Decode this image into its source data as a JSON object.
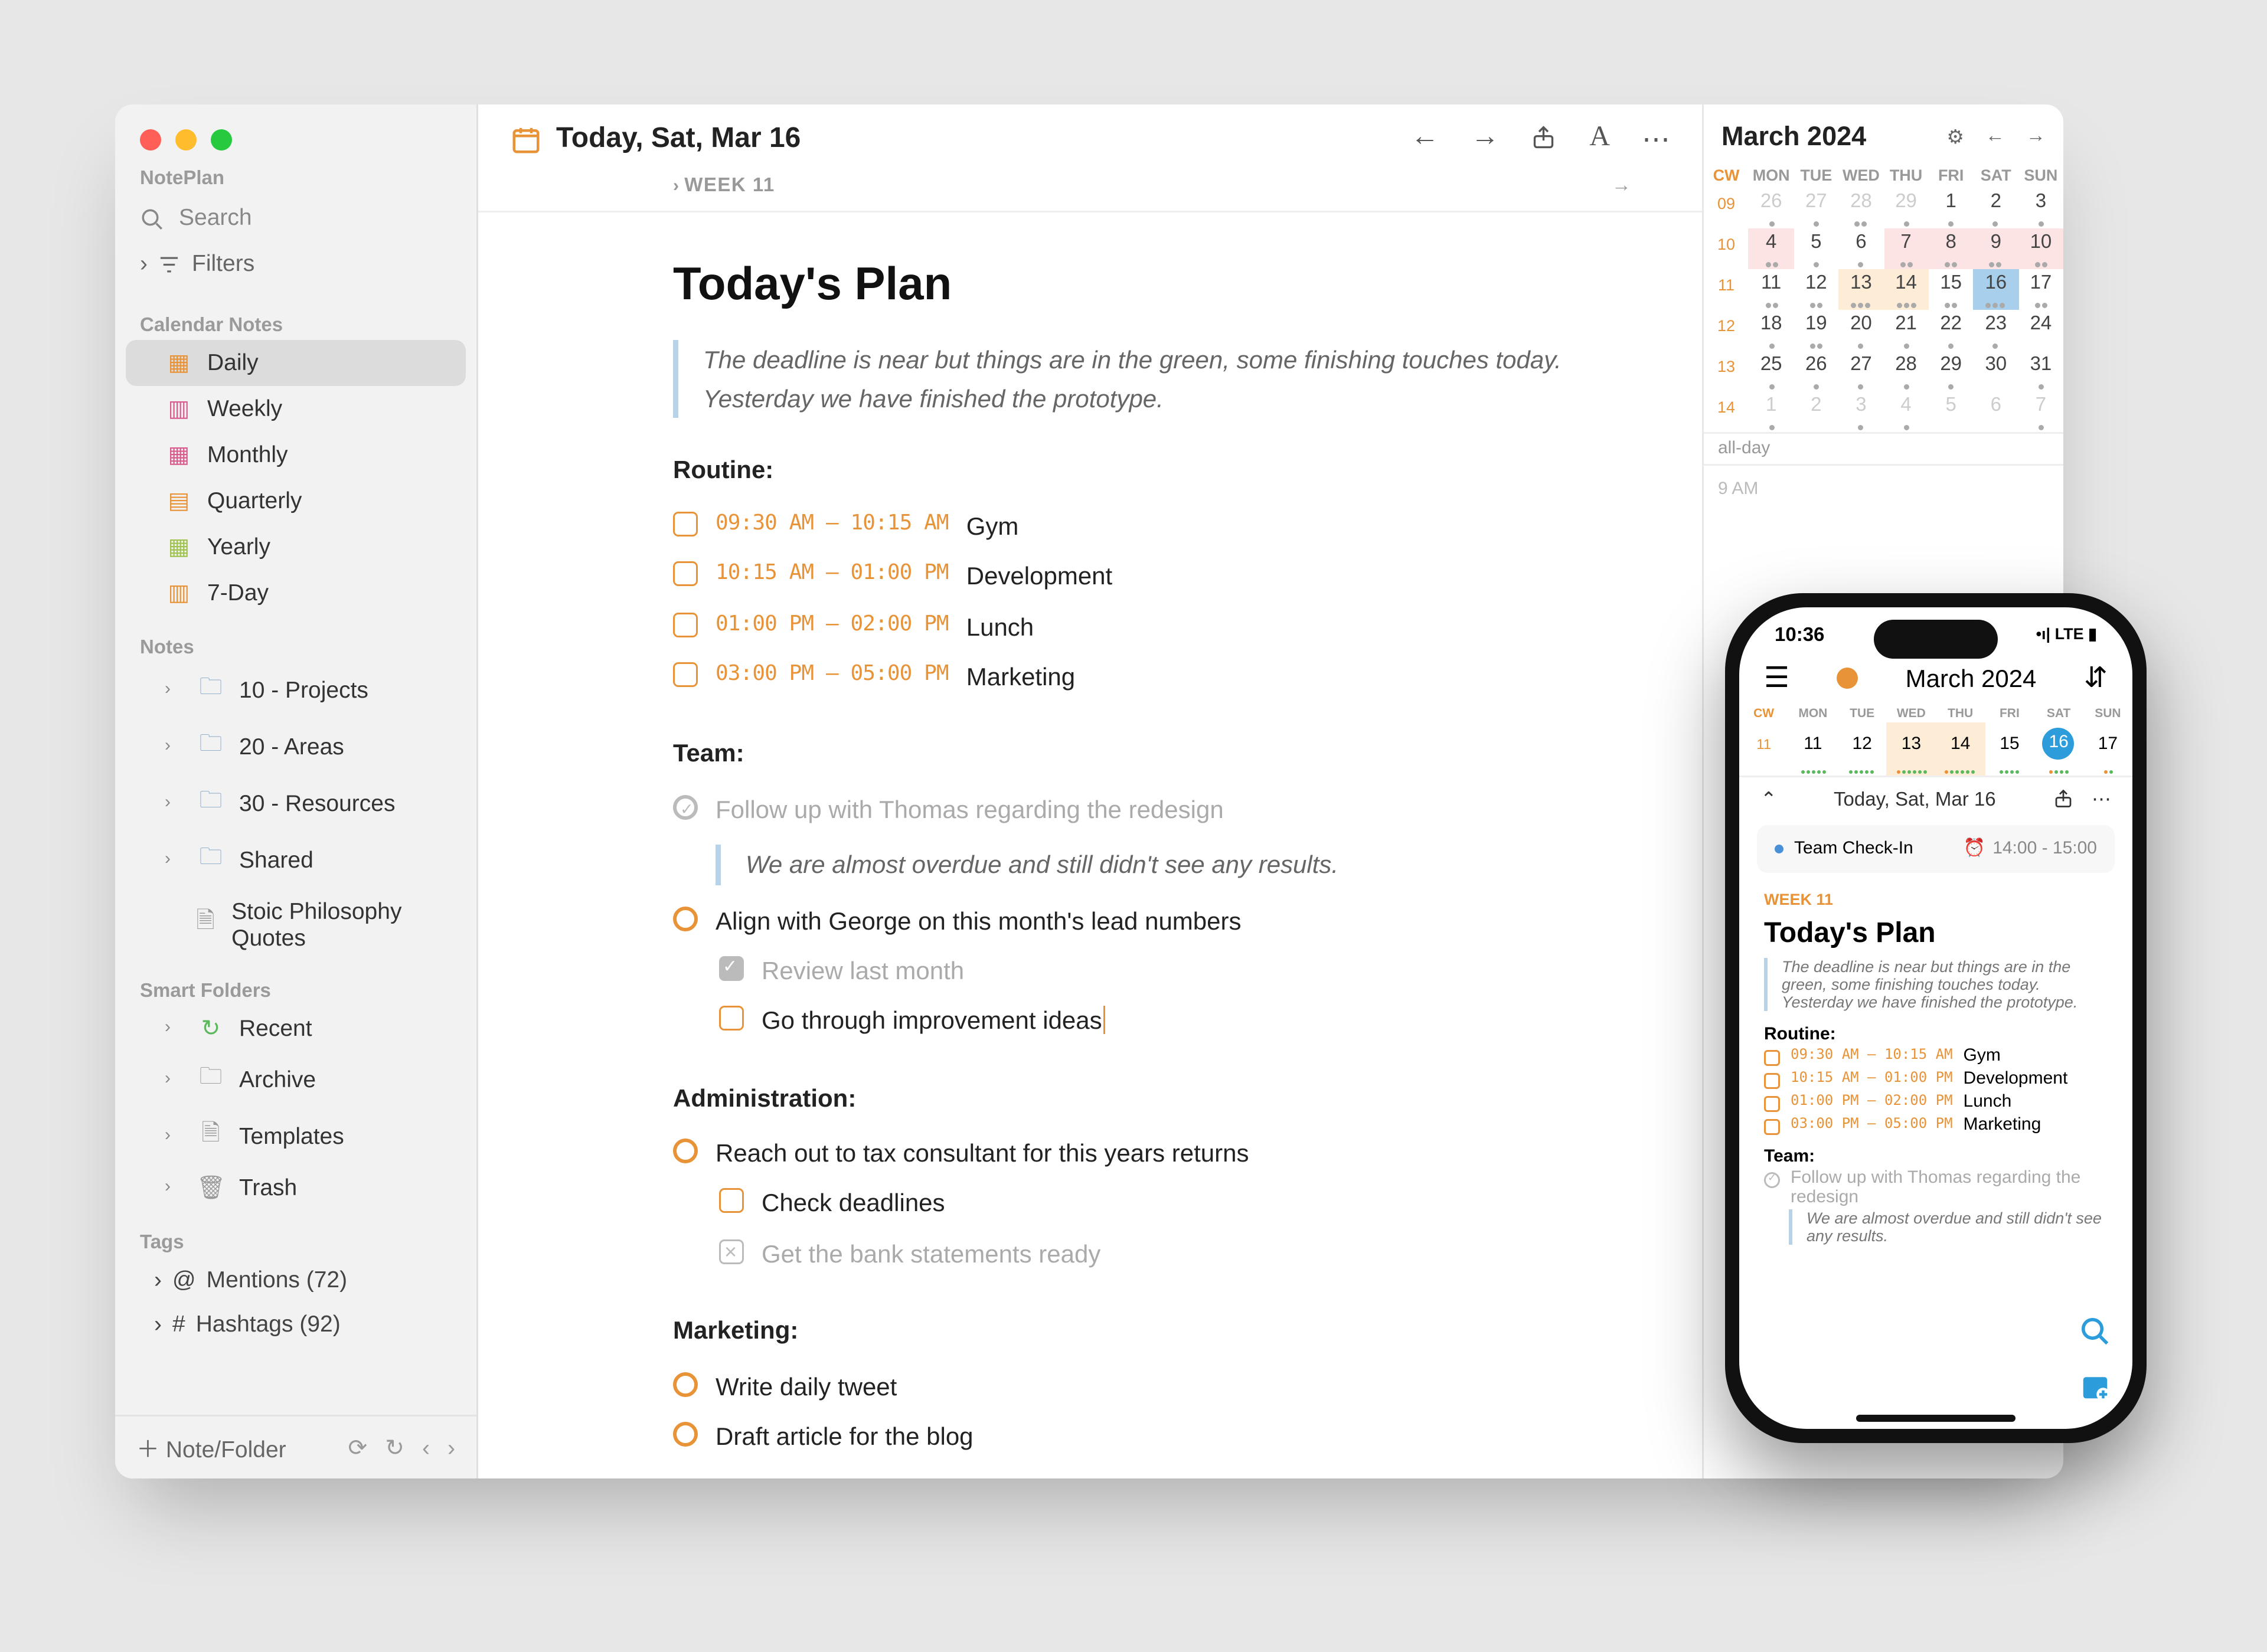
{
  "sidebar": {
    "app": "NotePlan",
    "search": "Search",
    "filters": "Filters",
    "cal_notes_h": "Calendar Notes",
    "cal_notes": [
      "Daily",
      "Weekly",
      "Monthly",
      "Quarterly",
      "Yearly",
      "7-Day"
    ],
    "notes_h": "Notes",
    "notes": [
      "10 - Projects",
      "20 - Areas",
      "30 - Resources",
      "Shared",
      "Stoic Philosophy Quotes"
    ],
    "smart_h": "Smart Folders",
    "smart": [
      "Recent",
      "Archive",
      "Templates",
      "Trash"
    ],
    "tags_h": "Tags",
    "mentions": "Mentions (72)",
    "hashtags": "Hashtags (92)",
    "add": "Note/Folder"
  },
  "editor": {
    "date": "Today, Sat, Mar 16",
    "week": "WEEK 11",
    "h1": "Today's Plan",
    "quote": "The deadline is near but things are in the green, some finishing touches today. Yesterday we have finished the prototype.",
    "routine_h": "Routine:",
    "routine": [
      {
        "time": "09:30 AM – 10:15 AM",
        "txt": "Gym"
      },
      {
        "time": "10:15 AM – 01:00 PM",
        "txt": "Development"
      },
      {
        "time": "01:00 PM – 02:00 PM",
        "txt": "Lunch"
      },
      {
        "time": "03:00 PM – 05:00 PM",
        "txt": "Marketing"
      }
    ],
    "team_h": "Team:",
    "team_done": "Follow up with Thomas regarding the redesign",
    "team_quote": "We are almost overdue and still didn't see any results.",
    "team_open": "Align with George on this month's lead numbers",
    "team_sub_done": "Review last month",
    "team_sub_open": "Go through improvement ideas",
    "admin_h": "Administration:",
    "admin_open": "Reach out to tax consultant for this years returns",
    "admin_sub": "Check deadlines",
    "admin_cancel": "Get the bank statements ready",
    "mkt_h": "Marketing:",
    "mkt": [
      "Write daily tweet",
      "Draft article for the blog"
    ]
  },
  "calendar": {
    "month": "March 2024",
    "dow": [
      "CW",
      "MON",
      "TUE",
      "WED",
      "THU",
      "FRI",
      "SAT",
      "SUN"
    ],
    "allday": "all-day",
    "nine": "9 AM"
  },
  "phone": {
    "time": "10:36",
    "signal": "LTE",
    "month": "March 2024",
    "dow": [
      "CW",
      "MON",
      "TUE",
      "WED",
      "THU",
      "FRI",
      "SAT",
      "SUN"
    ],
    "cw": "11",
    "days": [
      "11",
      "12",
      "13",
      "14",
      "15",
      "16",
      "17"
    ],
    "date": "Today, Sat, Mar 16",
    "event_name": "Team Check-In",
    "event_time": "14:00 - 15:00",
    "week": "WEEK 11",
    "h1": "Today's Plan",
    "quote": "The deadline is near but things are in the green, some finishing touches today. Yesterday we have finished the prototype.",
    "routine_h": "Routine:",
    "r0t": "09:30 AM – 10:15 AM",
    "r0": "Gym",
    "r1t": "10:15 AM – 01:00 PM",
    "r1": "Development",
    "r2t": "01:00 PM – 02:00 PM",
    "r2": "Lunch",
    "r3t": "03:00 PM – 05:00 PM",
    "r3": "Marketing",
    "team_h": "Team:",
    "team_done": "Follow up with Thomas regarding the redesign",
    "team_quote": "We are almost overdue and still didn't see any results."
  }
}
